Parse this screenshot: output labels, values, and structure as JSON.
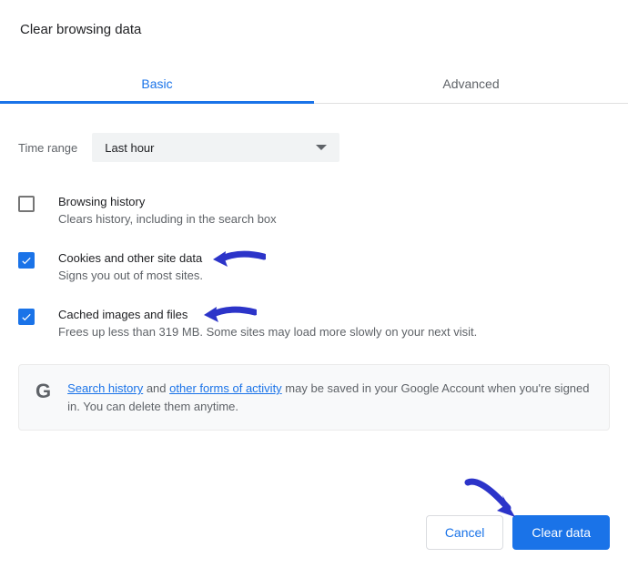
{
  "title": "Clear browsing data",
  "tabs": {
    "basic": "Basic",
    "advanced": "Advanced",
    "active": "basic"
  },
  "timerange": {
    "label": "Time range",
    "value": "Last hour"
  },
  "options": {
    "history": {
      "checked": false,
      "title": "Browsing history",
      "desc": "Clears history, including in the search box"
    },
    "cookies": {
      "checked": true,
      "title": "Cookies and other site data",
      "desc": "Signs you out of most sites."
    },
    "cache": {
      "checked": true,
      "title": "Cached images and files",
      "desc": "Frees up less than 319 MB. Some sites may load more slowly on your next visit."
    }
  },
  "info": {
    "link1": "Search history",
    "mid1": " and ",
    "link2": "other forms of activity",
    "rest": " may be saved in your Google Account when you're signed in. You can delete them anytime."
  },
  "buttons": {
    "cancel": "Cancel",
    "clear": "Clear data"
  }
}
